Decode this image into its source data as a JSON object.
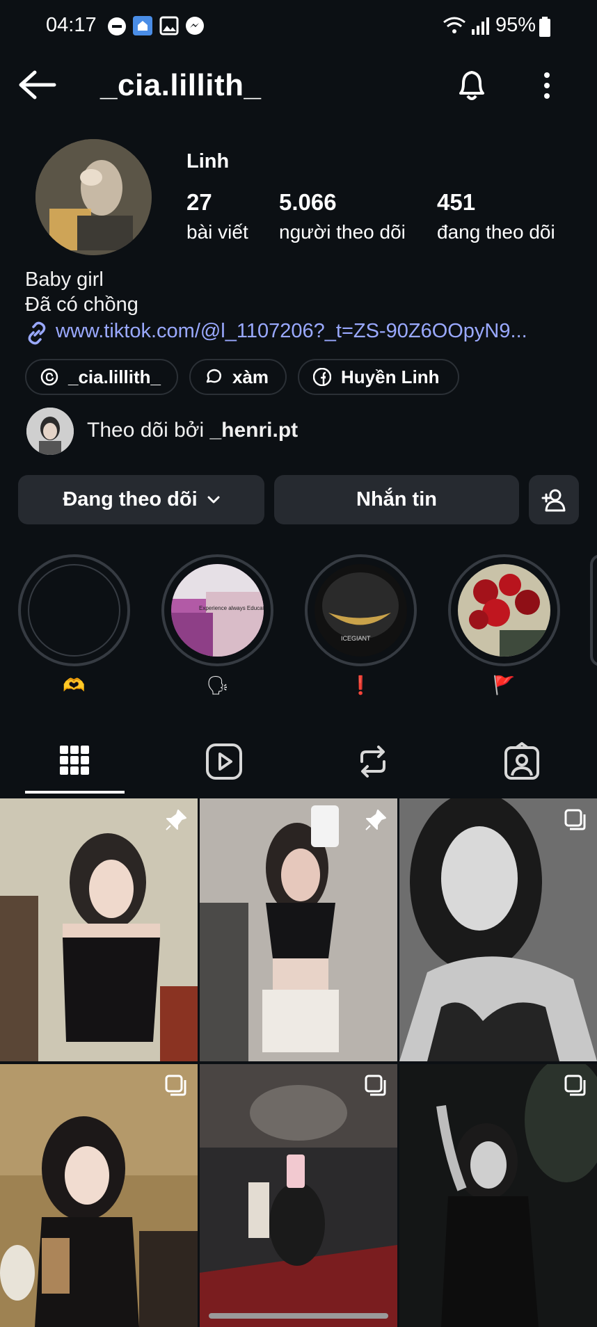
{
  "status_bar": {
    "time": "04:17",
    "battery": "95%"
  },
  "header": {
    "username": "_cia.lillith_"
  },
  "profile": {
    "display_name": "Linh",
    "stats": [
      {
        "value": "27",
        "label": "bài viết"
      },
      {
        "value": "5.066",
        "label": "người theo dõi"
      },
      {
        "value": "451",
        "label": "đang theo dõi"
      }
    ],
    "bio_lines": [
      "Baby girl",
      "Đã có chồng"
    ],
    "link": "www.tiktok.com/@l_1107206?_t=ZS-90Z6OOpyN9..."
  },
  "chips": [
    {
      "label": "_cia.lillith_",
      "icon": "threads-icon"
    },
    {
      "label": "xàm",
      "icon": "chat-icon"
    },
    {
      "label": "Huyền Linh",
      "icon": "facebook-icon"
    }
  ],
  "followed_by": {
    "prefix": "Theo dõi bởi ",
    "user": "_henri.pt"
  },
  "actions": {
    "following": "Đang theo dõi",
    "message": "Nhắn tin"
  },
  "highlights": [
    {
      "label": "🫶"
    },
    {
      "label": "🗣"
    },
    {
      "label": "❗"
    },
    {
      "label": "🚩"
    }
  ],
  "highlight_image_text": {
    "second": "Experience always Educate",
    "third": "ICEGIANT"
  },
  "tabs": [
    "grid-icon",
    "reels-icon",
    "reposts-icon",
    "tagged-icon"
  ],
  "colors": {
    "background": "#0c1014",
    "button": "#262a30",
    "link": "#9aa9ff"
  }
}
